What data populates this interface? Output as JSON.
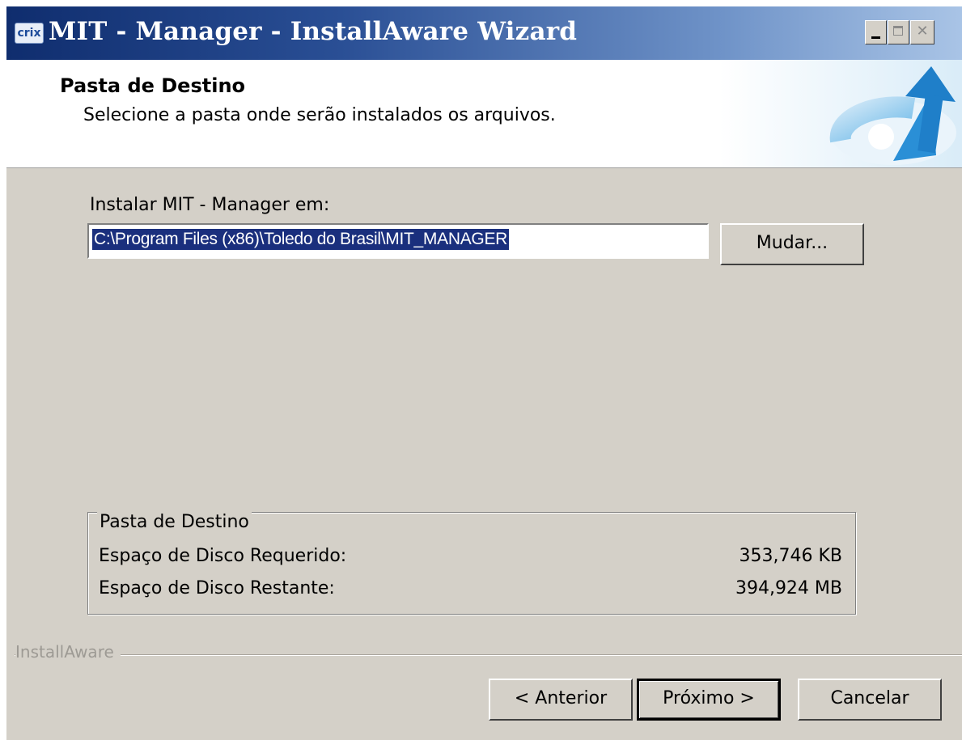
{
  "window": {
    "title": "MIT - Manager - InstallAware Wizard",
    "icon_label": "crix",
    "controls": {
      "minimize": "minimize-icon",
      "maximize": "maximize-icon",
      "close": "close-icon"
    }
  },
  "header": {
    "title": "Pasta de Destino",
    "subtitle": "Selecione a pasta onde serão instalados os arquivos."
  },
  "destination": {
    "label": "Instalar MIT - Manager em:",
    "path": "C:\\Program Files (x86)\\Toledo do Brasil\\MIT_MANAGER",
    "browse_label": "Mudar..."
  },
  "disk": {
    "group_title": "Pasta de Destino",
    "required_label": "Espaço de Disco Requerido:",
    "required_value": "353,746 KB",
    "remaining_label": "Espaço de Disco Restante:",
    "remaining_value": "394,924 MB"
  },
  "footer": {
    "brand": "InstallAware",
    "back_label": "< Anterior",
    "next_label": "Próximo >",
    "cancel_label": "Cancelar"
  },
  "colors": {
    "title_bar_start": "#0f2d6e",
    "title_bar_end": "#a9c4e6",
    "dialog_bg": "#d4d0c8",
    "selection_bg": "#1a2f7d",
    "accent_arrow": "#2a8fd6"
  }
}
